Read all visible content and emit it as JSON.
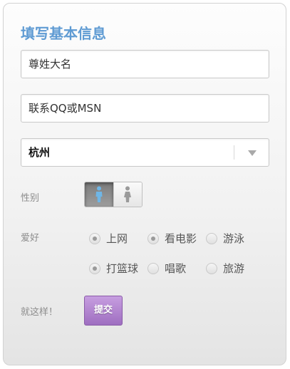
{
  "form": {
    "title": "填写基本信息",
    "name_placeholder": "尊姓大名",
    "contact_placeholder": "联系QQ或MSN",
    "city_value": "杭州",
    "gender_label": "性别",
    "hobby_label": "爱好",
    "hobbies": [
      {
        "label": "上网",
        "checked": true
      },
      {
        "label": "看电影",
        "checked": true
      },
      {
        "label": "游泳",
        "checked": false
      },
      {
        "label": "打篮球",
        "checked": true
      },
      {
        "label": "唱歌",
        "checked": false
      },
      {
        "label": "旅游",
        "checked": false
      }
    ],
    "submit_prompt": "就这样！",
    "submit_label": "提交"
  },
  "icons": {
    "select_arrow": "chevron-down-icon",
    "male": "male-icon",
    "female": "female-icon"
  },
  "colors": {
    "title": "#5f9bd3",
    "submit": "#a678c8",
    "male_icon": "#6fb6e6"
  }
}
